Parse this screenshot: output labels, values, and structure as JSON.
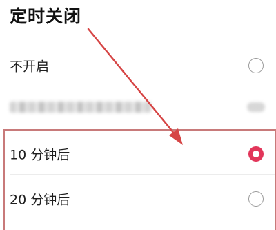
{
  "page": {
    "title": "定时关闭"
  },
  "options": [
    {
      "label": "不开启",
      "selected": false
    },
    {
      "label": "",
      "selected": false,
      "obscured": true
    },
    {
      "label": "10 分钟后",
      "selected": true
    },
    {
      "label": "20 分钟后",
      "selected": false
    }
  ],
  "colors": {
    "accent": "#e2365a",
    "annotation": "#d64545",
    "highlight_border": "#c87a7a",
    "radio_border": "#9a9a9a"
  }
}
